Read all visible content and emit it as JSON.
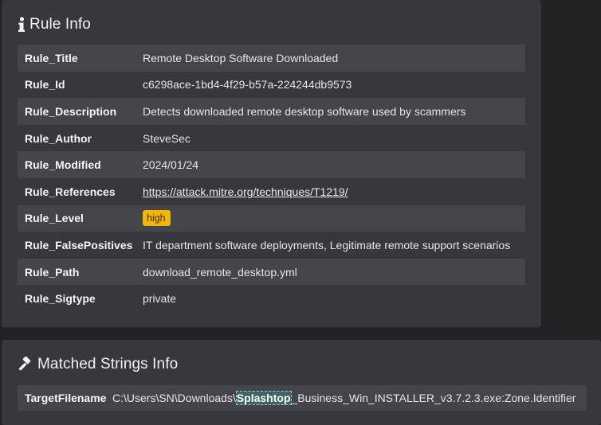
{
  "rule_info": {
    "title": "Rule Info",
    "icon": "info-icon",
    "rows": [
      {
        "key": "Rule_Title",
        "value": "Remote Desktop Software Downloaded"
      },
      {
        "key": "Rule_Id",
        "value": "c6298ace-1bd4-4f29-b57a-224244db9573"
      },
      {
        "key": "Rule_Description",
        "value": "Detects downloaded remote desktop software used by scammers"
      },
      {
        "key": "Rule_Author",
        "value": "SteveSec"
      },
      {
        "key": "Rule_Modified",
        "value": "2024/01/24"
      },
      {
        "key": "Rule_References",
        "value": "https://attack.mitre.org/techniques/T1219/"
      },
      {
        "key": "Rule_Level",
        "value": "high"
      },
      {
        "key": "Rule_FalsePositives",
        "value": "IT department software deployments, Legitimate remote support scenarios"
      },
      {
        "key": "Rule_Path",
        "value": "download_remote_desktop.yml"
      },
      {
        "key": "Rule_Sigtype",
        "value": "private"
      }
    ]
  },
  "matched_strings": {
    "title": "Matched Strings Info",
    "icon": "gavel-icon",
    "row": {
      "key": "TargetFilename",
      "value_prefix": "C:\\Users\\SN\\Downloads\\",
      "value_match": "Splashtop",
      "value_suffix": "_Business_Win_INSTALLER_v3.7.2.3.exe:Zone.Identifier"
    }
  },
  "colors": {
    "panel_bg": "#36383d",
    "row_stripe": "#43454a",
    "badge_high": "#f2b705",
    "match_highlight": "#3e6468"
  }
}
